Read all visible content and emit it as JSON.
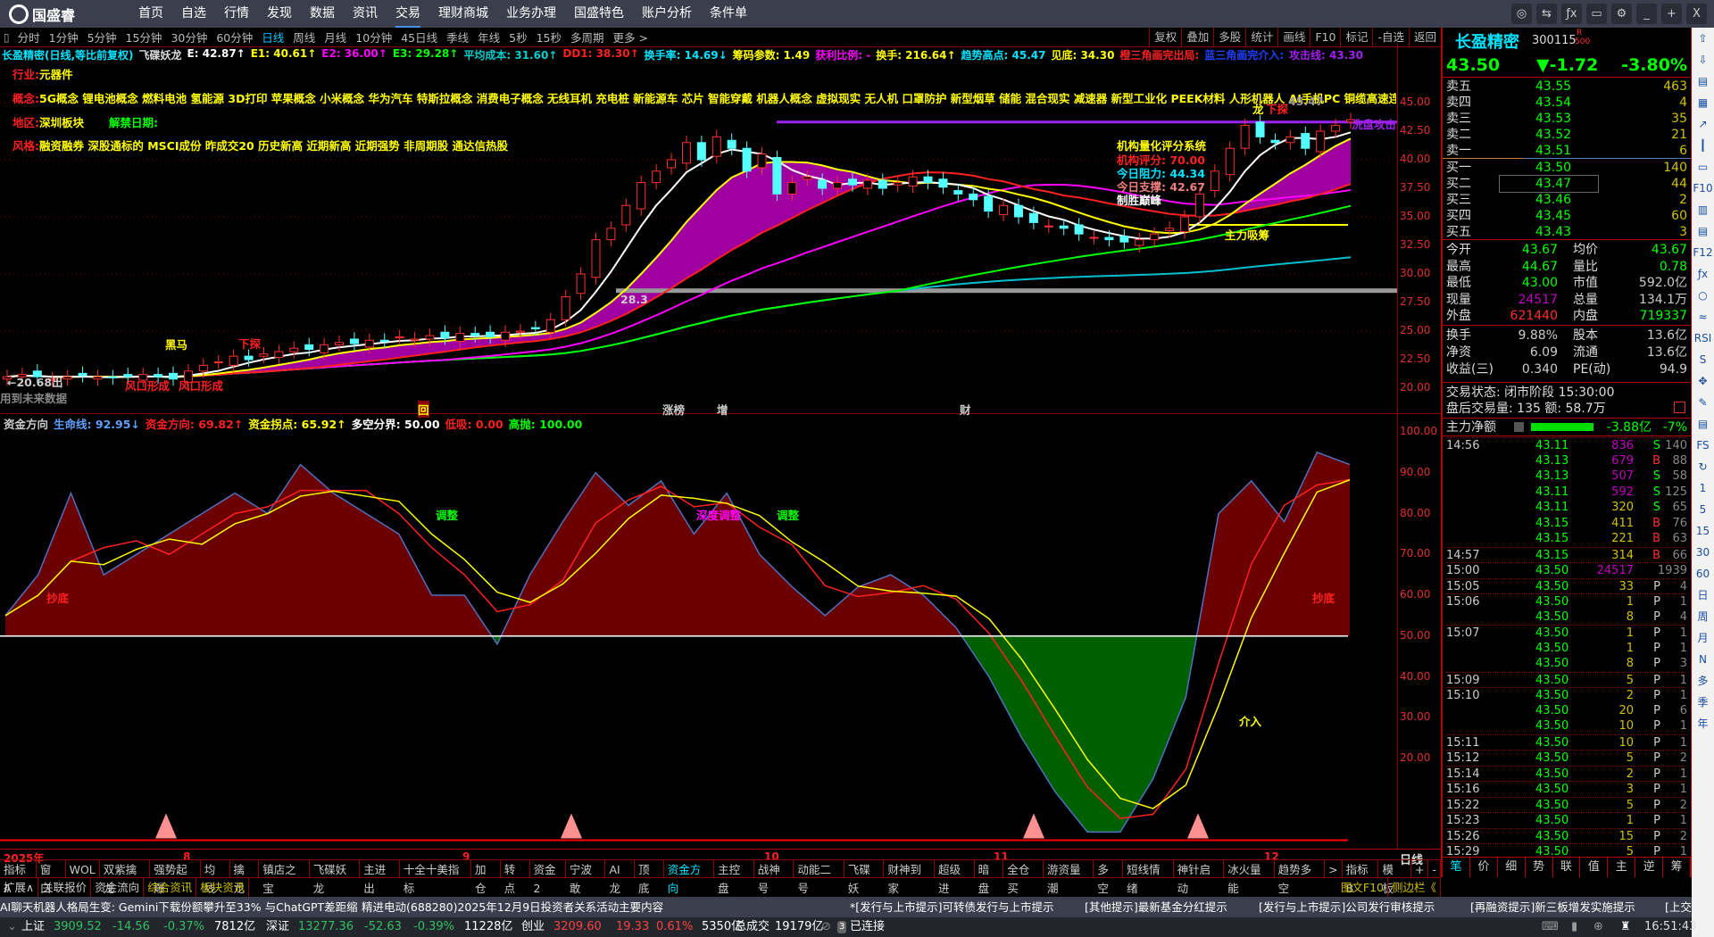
{
  "nav": {
    "logo": "国盛睿",
    "items": [
      "首页",
      "自选",
      "行情",
      "发现",
      "数据",
      "资讯",
      "交易",
      "理财商城",
      "业务办理",
      "国盛特色",
      "账户分析",
      "条件单"
    ],
    "active": 6,
    "window_buttons": [
      "◎",
      "⇆",
      "ƒx",
      "▭",
      "⚙",
      "_",
      "+",
      "X"
    ]
  },
  "periods": {
    "items": [
      "分时",
      "1分钟",
      "5分钟",
      "15分钟",
      "30分钟",
      "60分钟",
      "日线",
      "周线",
      "月线",
      "10分钟",
      "45日线",
      "季线",
      "年线",
      "5秒",
      "15秒",
      "多周期",
      "更多 >"
    ],
    "active": 6,
    "right_buttons": [
      "复权",
      "叠加",
      "多股",
      "统计",
      "画线",
      "F10",
      "标记",
      "-自选",
      "返回"
    ]
  },
  "info": [
    {
      "t": "长盈精密(日线,等比前复权)",
      "c": "#00e5ff"
    },
    {
      "t": "飞碟妖龙",
      "c": "#ddd"
    },
    {
      "t": "E: 42.87↑",
      "c": "#fff"
    },
    {
      "t": "E1: 40.61↑",
      "c": "#ffff00"
    },
    {
      "t": "E2: 36.00↑",
      "c": "#ff00ff"
    },
    {
      "t": "E3: 29.28↑",
      "c": "#00ff00"
    },
    {
      "t": "平均成本: 31.60↑",
      "c": "#00cccc"
    },
    {
      "t": "DD1: 38.30↑",
      "c": "#ff2020"
    },
    {
      "t": "换手率: 14.69↓",
      "c": "#00e5ff"
    },
    {
      "t": "筹码参数: 1.49",
      "c": "#ffff00"
    },
    {
      "t": "获利比例: -",
      "c": "#ff00ff"
    },
    {
      "t": "换手: 216.64↑",
      "c": "#ffff00"
    },
    {
      "t": "趋势高点: 45.47",
      "c": "#00e5ff"
    },
    {
      "t": "见底: 34.30",
      "c": "#ffff00"
    },
    {
      "t": "橙三角画完出局:",
      "c": "#ff2020"
    },
    {
      "t": "蓝三角画完介入:",
      "c": "#2040ff"
    },
    {
      "t": "攻击线: 43.30",
      "c": "#a020f0"
    }
  ],
  "profile": {
    "industry_label": "行业:",
    "industry": "元器件",
    "concept_label": "概念:",
    "concepts": "5G概念 锂电池概念 燃料电池 氢能源 3D打印 苹果概念 小米概念 华为汽车 特斯拉概念 消费电子概念 无线耳机 充电桩 新能源车 芯片 智能穿戴 机器人概念 虚拟现实 无人机 口罩防护 新型烟草 储能 混合现实 减速器 新型工业化 PEEK材料 人形机器人 AI手机PC 铜缆高速连",
    "region_label": "地区:",
    "region": "深圳板块",
    "unlock_label": "解禁日期:",
    "style_label": "风格:",
    "style": "融资融券 深股通标的 MSCI成份 昨成交20 历史新高 近期新高 近期强势 非周期股 通达信热股"
  },
  "score": {
    "title": "机构量化评分系统",
    "rating_label": "机构评分:",
    "rating": "70.00",
    "resist_label": "今日阻力:",
    "resist": "44.34",
    "support_label": "今日支撑:",
    "support": "42.67",
    "peak": "制胜巅峰"
  },
  "annotations": {
    "dragon": "龙",
    "probe": "下探",
    "wash": "洗盘攻击",
    "absorb": "主力吸筹",
    "wind1": "风口形成",
    "wind2": "风口形成",
    "horse": "黑马",
    "low": "←20.68出",
    "future": "用到未来数据",
    "high": "45.47",
    "mid": "28.3",
    "m1": "回",
    "m2": "涨榜",
    "m3": "增",
    "m4": "财",
    "ind_a": "调整",
    "ind_b": "深度调整",
    "ind_c": "调整",
    "ind_d": "抄底",
    "ind_e": "抄底",
    "ind_f": "介入"
  },
  "price_axis": [
    "45.00",
    "42.50",
    "40.00",
    "37.50",
    "35.00",
    "32.50",
    "30.00",
    "27.50",
    "25.00",
    "22.50",
    "20.00"
  ],
  "ind_axis": [
    "100.00",
    "90.00",
    "80.00",
    "70.00",
    "60.00",
    "50.00",
    "40.00",
    "30.00",
    "20.00"
  ],
  "indicator_header": [
    {
      "t": "资金方向",
      "c": "#ccc"
    },
    {
      "t": "生命线: 92.95↓",
      "c": "#5fa0ff"
    },
    {
      "t": "资金方向: 69.82↑",
      "c": "#ff2020"
    },
    {
      "t": "资金拐点: 65.92↑",
      "c": "#ffff00"
    },
    {
      "t": "多空分界: 50.00",
      "c": "#fff"
    },
    {
      "t": "低吸: 0.00",
      "c": "#ff2020"
    },
    {
      "t": "高抛: 100.00",
      "c": "#00ff00"
    }
  ],
  "chart_data": {
    "type": "candlestick",
    "title": "长盈精密 日线",
    "ylim": [
      20,
      45
    ],
    "closes": [
      21,
      21.2,
      21,
      20.8,
      21,
      21.1,
      21,
      20.9,
      21,
      21.2,
      21,
      20.8,
      21.5,
      22,
      22.3,
      22.8,
      22.5,
      23,
      23.2,
      23.5,
      23.4,
      23.8,
      24,
      23.9,
      24.2,
      24.1,
      24.5,
      24.3,
      24.6,
      24.4,
      24.8,
      24.6,
      24.5,
      24.9,
      25,
      25.2,
      26,
      28,
      30,
      33,
      34,
      36,
      38,
      39,
      40,
      41.5,
      40,
      42,
      41,
      39,
      40.5,
      37,
      38,
      38.5,
      37.5,
      38,
      37.8,
      38.2,
      37.5,
      38,
      38.5,
      38,
      37.6,
      37,
      36.5,
      35.5,
      36,
      35,
      34.5,
      34.2,
      34,
      33.5,
      33.2,
      33,
      32.8,
      33,
      33.5,
      34,
      35,
      37,
      39,
      41,
      43,
      42,
      41.5,
      42,
      41,
      42.5,
      43,
      43.5
    ],
    "indicator": {
      "name": "资金方向",
      "ylim": [
        0,
        100
      ],
      "baseline": 50,
      "values": [
        55,
        65,
        85,
        65,
        70,
        75,
        80,
        85,
        80,
        92,
        85,
        80,
        75,
        60,
        60,
        48,
        65,
        78,
        90,
        82,
        88,
        75,
        85,
        70,
        62,
        55,
        62,
        65,
        60,
        52,
        40,
        25,
        12,
        2,
        2,
        15,
        35,
        80,
        88,
        78,
        95,
        92
      ]
    },
    "x_labels": [
      "2025年",
      "8",
      "9",
      "10",
      "11",
      "12"
    ],
    "period_label": "日线"
  },
  "stock": {
    "name": "长盈精密",
    "code": "300115",
    "tag_r": "R",
    "tag_500": "500",
    "price": "43.50",
    "change": "▼-1.72",
    "pct": "-3.80%"
  },
  "book": {
    "sell": [
      [
        "卖五",
        "43.55",
        "463"
      ],
      [
        "卖四",
        "43.54",
        "4"
      ],
      [
        "卖三",
        "43.53",
        "35"
      ],
      [
        "卖二",
        "43.52",
        "21"
      ],
      [
        "卖一",
        "43.51",
        "6"
      ]
    ],
    "buy": [
      [
        "买一",
        "43.50",
        "140"
      ],
      [
        "买二",
        "43.47",
        "44"
      ],
      [
        "买三",
        "43.46",
        "2"
      ],
      [
        "买四",
        "43.45",
        "60"
      ],
      [
        "买五",
        "43.43",
        "3"
      ]
    ]
  },
  "stats": [
    [
      "今开",
      "43.67",
      "均价",
      "43.67"
    ],
    [
      "最高",
      "44.67",
      "量比",
      "0.78"
    ],
    [
      "最低",
      "43.00",
      "市值",
      "592.0亿"
    ],
    [
      "现量",
      "24517",
      "总量",
      "134.1万"
    ],
    [
      "外盘",
      "621440",
      "内盘",
      "719337"
    ]
  ],
  "fund": [
    [
      "换手",
      "9.88%",
      "股本",
      "13.6亿"
    ],
    [
      "净资",
      "6.09",
      "流通",
      "13.6亿"
    ],
    [
      "收益(三)",
      "0.340",
      "PE(动)",
      "94.9"
    ]
  ],
  "trade_state": "交易状态: 闭市阶段 15:30:00",
  "after_hours": "盘后交易量: 135  额: 58.7万",
  "main_net": {
    "label": "主力净额",
    "value": "-3.88亿",
    "pct": "-7%"
  },
  "ticks": [
    [
      "14:56",
      "43.11",
      "836",
      "S",
      "140"
    ],
    [
      "",
      "43.13",
      "679",
      "B",
      "88"
    ],
    [
      "",
      "43.13",
      "507",
      "S",
      "58"
    ],
    [
      "",
      "43.11",
      "592",
      "S",
      "125"
    ],
    [
      "",
      "43.11",
      "320",
      "S",
      "65"
    ],
    [
      "",
      "43.15",
      "411",
      "B",
      "76"
    ],
    [
      "",
      "43.15",
      "221",
      "B",
      "63"
    ],
    [
      "14:57",
      "43.15",
      "314",
      "B",
      "66"
    ],
    [
      "15:00",
      "43.50",
      "24517",
      "",
      "1939"
    ],
    [
      "15:05",
      "43.50",
      "33",
      "P",
      "4"
    ],
    [
      "15:06",
      "43.50",
      "1",
      "P",
      "1"
    ],
    [
      "",
      "43.50",
      "8",
      "P",
      "4"
    ],
    [
      "15:07",
      "43.50",
      "1",
      "P",
      "1"
    ],
    [
      "",
      "43.50",
      "1",
      "P",
      "1"
    ],
    [
      "",
      "43.50",
      "8",
      "P",
      "3"
    ],
    [
      "15:09",
      "43.50",
      "5",
      "P",
      "1"
    ],
    [
      "15:10",
      "43.50",
      "2",
      "P",
      "1"
    ],
    [
      "",
      "43.50",
      "20",
      "P",
      "6"
    ],
    [
      "",
      "43.50",
      "10",
      "P",
      "1"
    ],
    [
      "15:11",
      "43.50",
      "10",
      "P",
      "1"
    ],
    [
      "15:12",
      "43.50",
      "5",
      "P",
      "2"
    ],
    [
      "15:14",
      "43.50",
      "2",
      "P",
      "1"
    ],
    [
      "15:16",
      "43.50",
      "3",
      "P",
      "1"
    ],
    [
      "15:22",
      "43.50",
      "5",
      "P",
      "2"
    ],
    [
      "15:23",
      "43.50",
      "1",
      "P",
      "1"
    ],
    [
      "15:26",
      "43.50",
      "15",
      "P",
      "2"
    ],
    [
      "15:29",
      "43.50",
      "5",
      "P",
      "1"
    ]
  ],
  "right_tabs": [
    "笔",
    "价",
    "细",
    "势",
    "联",
    "值",
    "主",
    "逆",
    "筹"
  ],
  "sidebar": [
    "⇧",
    "⇩",
    "▤",
    "▦",
    "↗",
    "┃",
    "▭",
    "F10",
    "▥",
    "▤",
    "F12",
    "ƒx",
    "○",
    "≈",
    "RSI",
    "S",
    "✥",
    "✎",
    "▤",
    "FS",
    "↻",
    "1",
    "5",
    "15",
    "30",
    "60",
    "日",
    "周",
    "月",
    "N",
    "多",
    "季",
    "年"
  ],
  "toolbar1": [
    "指标A",
    "窗口",
    "WOL",
    "双紫擒龙",
    "强势起爆",
    "均线",
    "擒龙",
    "镇店之宝",
    "飞碟妖龙",
    "主进出",
    "十全十美指标",
    "加仓",
    "转点",
    "资金2",
    "宁波敢",
    "AI龙",
    "顶底",
    "资金方向",
    "主控盘",
    "战神号",
    "动能二号",
    "飞碟妖",
    "财神到家",
    "超级进",
    "暗盘",
    "全仓买",
    "游资量潮",
    "多空",
    "短线情绪",
    "神针启动",
    "冰火量能",
    "趋势多空",
    ">",
    "指标B",
    "模 板",
    "+",
    "-"
  ],
  "toolbar1_active": 17,
  "toolbar2": [
    "扩展∧",
    "关联报价",
    "资金流向",
    "综合资讯",
    "板块资讯"
  ],
  "toolbar2_right": [
    "图文F10",
    "侧边栏《"
  ],
  "news": [
    "AI聊天机器人格局生变: Gemini下载份额攀升至33% 与ChatGPT差距缩",
    "精进电动(688280)2025年12月9日投资者关系活动主要内容",
    "*[发行与上市提示]可转债发行与上市提示",
    "[其他提示]最新基金分红提示",
    "[发行与上市提示]公司发行审核提示",
    "[再融资提示]新三板增发实施提示",
    "[上交"
  ],
  "status": {
    "sh": "上证",
    "sh_v": "3909.52",
    "sh_c": "-14.56",
    "sh_p": "-0.37%",
    "sh_a": "7812亿",
    "sz": "深证",
    "sz_v": "13277.36",
    "sz_c": "-52.63",
    "sz_p": "-0.39%",
    "sz_a": "11228亿",
    "cy": "创业",
    "cy_v": "3209.60",
    "cy_c": "19.33",
    "cy_p": "0.61%",
    "cy_a": "5350亿",
    "total_l": "总成交",
    "total": "19179亿",
    "conn": "已连接",
    "time": "16:51:43"
  },
  "colors": {
    "up": "#ff3030",
    "down": "#54ffff",
    "ma5": "#ffffff",
    "ma10": "#ffff00",
    "ma20": "#ff2020",
    "ma30": "#ff00ff",
    "ma60": "#00ff00",
    "ma120": "#00c0d0",
    "fill": "#a000a0"
  }
}
